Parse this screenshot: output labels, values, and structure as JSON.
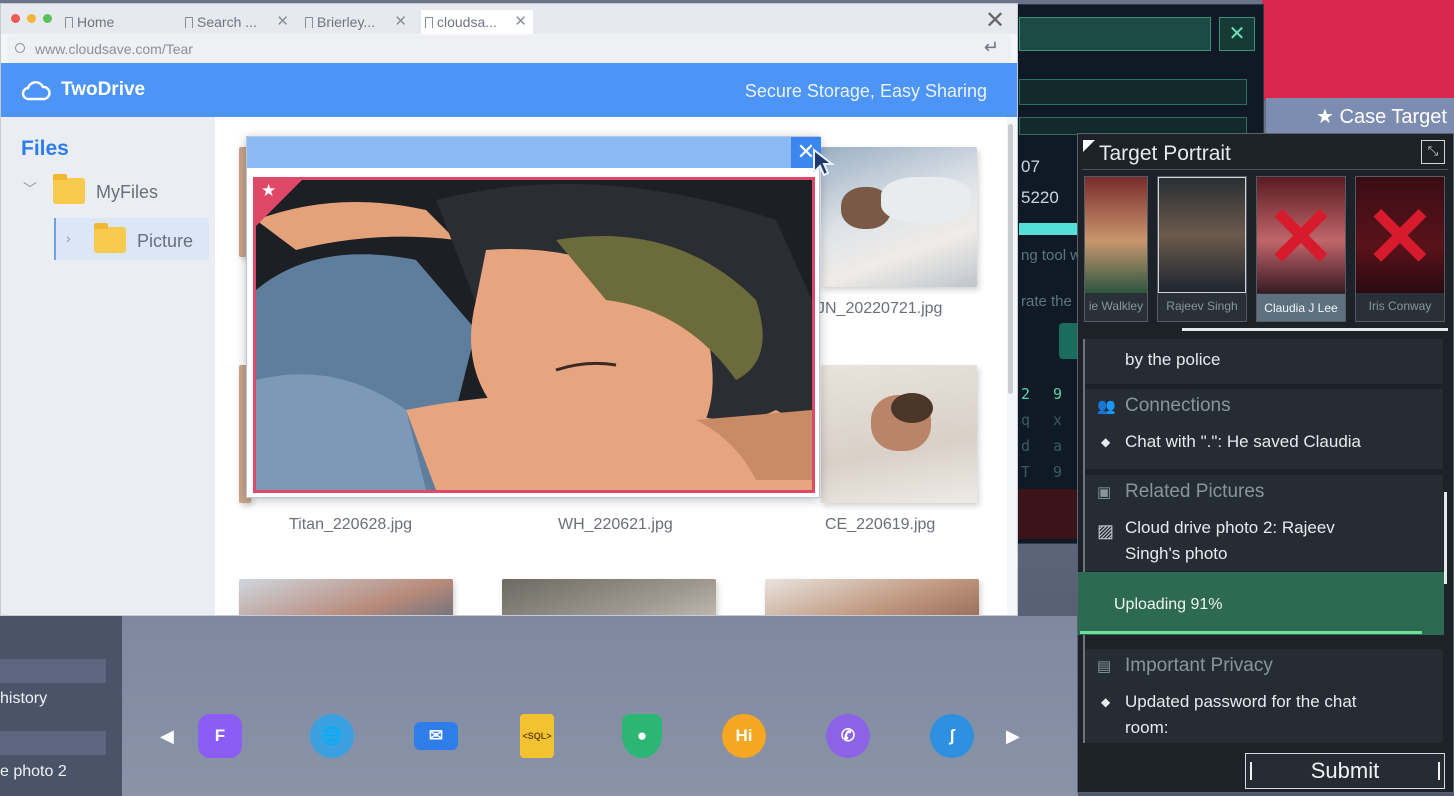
{
  "browser": {
    "tabs": [
      {
        "label": "Home",
        "active": false
      },
      {
        "label": "Search ...",
        "active": false
      },
      {
        "label": "Brierley...",
        "active": false
      },
      {
        "label": "cloudsa...",
        "active": true
      }
    ],
    "url": "www.cloudsave.com/Tear",
    "close_icon": "close-icon"
  },
  "app": {
    "brand": "TwoDrive",
    "slogan": "Secure Storage, Easy Sharing",
    "sidebar": {
      "title": "Files",
      "folders": [
        {
          "label": "MyFiles",
          "expanded": true
        },
        {
          "label": "Picture",
          "selected": true
        }
      ]
    },
    "captions": [
      "Titan_220628.jpg",
      "WH_220621.jpg",
      "CE_220619.jpg",
      "JN_20220721.jpg"
    ]
  },
  "hacker": {
    "numbers": [
      "07",
      "5220"
    ],
    "fragments": [
      "ng tool w",
      "rate the"
    ],
    "grid_row1": "2 9",
    "grid_rows": [
      "q x",
      "d a",
      "T 9"
    ]
  },
  "dock": {
    "left_labels": [
      "history",
      "e photo 2"
    ],
    "icons": [
      {
        "name": "chat-app-icon",
        "label": "F",
        "color": "#8b5cf6"
      },
      {
        "name": "globe-icon",
        "label": "",
        "color": "#3ba0e0"
      },
      {
        "name": "mail-icon",
        "label": "",
        "color": "#2f7de8"
      },
      {
        "name": "sql-file-icon",
        "label": "<SQL>",
        "color": "#f2c230"
      },
      {
        "name": "shield-icon",
        "label": "",
        "color": "#2bb673"
      },
      {
        "name": "hi-chat-icon",
        "label": "Hi",
        "color": "#f5a623"
      },
      {
        "name": "phone-icon",
        "label": "",
        "color": "#8d63e6"
      },
      {
        "name": "hook-icon",
        "label": "",
        "color": "#2f8fe0"
      }
    ]
  },
  "case": {
    "case_target_label": "Case Target",
    "panel_title": "Target Portrait",
    "portraits": [
      {
        "name": "ie Walkley",
        "selected": false,
        "crossed": false
      },
      {
        "name": "Rajeev Singh",
        "selected": false,
        "crossed": false
      },
      {
        "name": "Claudia J Lee",
        "selected": true,
        "crossed": true
      },
      {
        "name": "Iris Conway",
        "selected": false,
        "crossed": true
      }
    ],
    "sections": {
      "top_item": "by the police",
      "connections_header": "Connections",
      "connections_item": "Chat with \".\": He saved Claudia",
      "related_header": "Related Pictures",
      "related_item_line1": "Cloud drive photo 2: Rajeev",
      "related_item_line2": "Singh's photo",
      "uploading": "Uploading  91%",
      "uploading_progress": 0.91,
      "privacy_header": "Important Privacy",
      "privacy_item_line1": "Updated password for the chat",
      "privacy_item_line2": "room:"
    },
    "submit": "Submit"
  },
  "colors": {
    "accent_blue": "#4c94f5",
    "frame_pink": "#e04868",
    "upload_green": "#2c6b52",
    "cross_red": "#d81b2c"
  }
}
